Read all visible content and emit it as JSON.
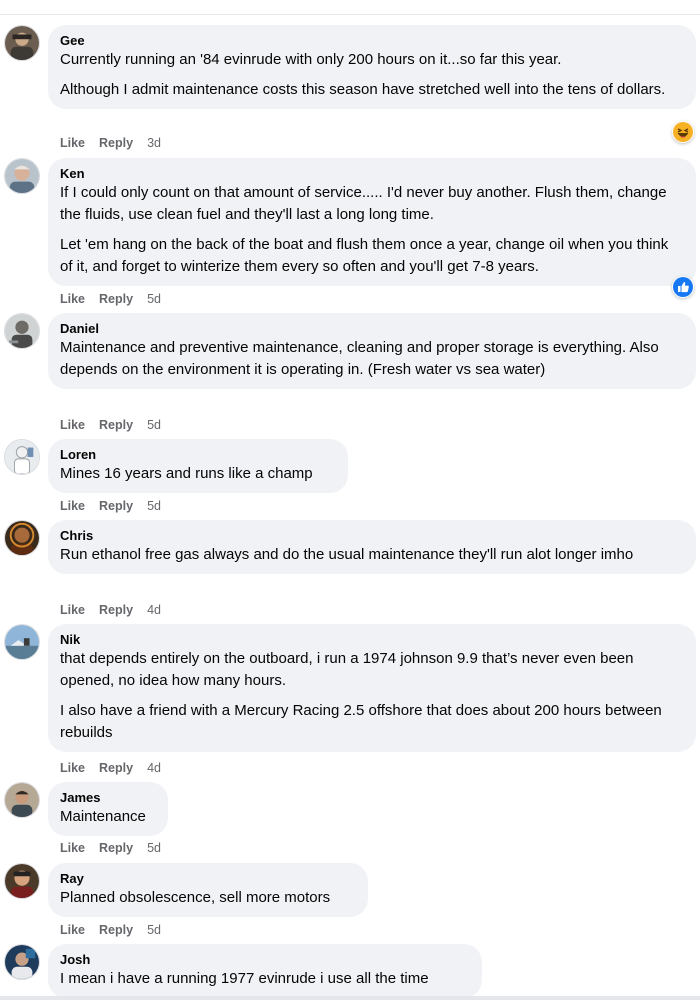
{
  "comments": [
    {
      "name": "Gee",
      "paragraphs": [
        "Currently running an '84 evinrude with only 200 hours on it...so far this year.",
        "Although I admit maintenance costs this season have stretched well into the tens of dollars."
      ],
      "like_label": "Like",
      "reply_label": "Reply",
      "age": "3d",
      "reaction": "haha-icon"
    },
    {
      "name": "Ken",
      "paragraphs": [
        "If I could only count on that amount of service..... I'd never buy another. Flush them, change the fluids, use clean fuel and they'll last a long long time.",
        "Let 'em hang on the back of the boat and flush them once a year, change oil when you think of it, and forget to winterize them every so often and you'll get 7-8 years."
      ],
      "like_label": "Like",
      "reply_label": "Reply",
      "age": "5d",
      "reaction": "like-icon"
    },
    {
      "name": "Daniel",
      "paragraphs": [
        "Maintenance and preventive maintenance, cleaning and proper storage is everything. Also depends on the environment it is operating in. (Fresh water vs sea water)"
      ],
      "like_label": "Like",
      "reply_label": "Reply",
      "age": "5d"
    },
    {
      "name": "Loren",
      "paragraphs": [
        "Mines 16 years and runs like a champ"
      ],
      "like_label": "Like",
      "reply_label": "Reply",
      "age": "5d"
    },
    {
      "name": "Chris",
      "paragraphs": [
        "Run ethanol free gas always and do the usual maintenance they'll run alot longer imho"
      ],
      "like_label": "Like",
      "reply_label": "Reply",
      "age": "4d"
    },
    {
      "name": "Nik",
      "paragraphs": [
        "that depends entirely on the outboard, i run a 1974 johnson 9.9 that’s never even been opened, no idea how many hours.",
        "I also have a friend with a Mercury Racing 2.5 offshore that does about 200 hours between rebuilds"
      ],
      "like_label": "Like",
      "reply_label": "Reply",
      "age": "4d"
    },
    {
      "name": "James",
      "paragraphs": [
        "Maintenance"
      ],
      "like_label": "Like",
      "reply_label": "Reply",
      "age": "5d"
    },
    {
      "name": "Ray",
      "paragraphs": [
        "Planned obsolescence, sell more motors"
      ],
      "like_label": "Like",
      "reply_label": "Reply",
      "age": "5d"
    },
    {
      "name": "Josh",
      "paragraphs": [
        "I mean i have a running 1977 evinrude i use all the time"
      ]
    }
  ],
  "colors": {
    "bubble": "#f0f2f5",
    "meta_text": "#65676b",
    "like_blue": "#1877f2",
    "haha_yellow": "#f7b125"
  }
}
